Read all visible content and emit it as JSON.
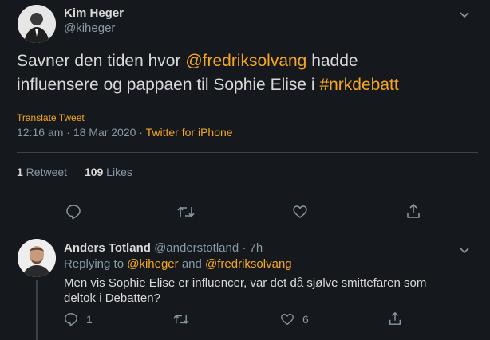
{
  "main_tweet": {
    "author_name": "Kim Heger",
    "author_handle": "@kiheger",
    "text_part1": "Savner den tiden hvor ",
    "mention": "@fredriksolvang",
    "text_part2": " hadde",
    "text_line2": "influensere og pappaen til Sophie Elise i ",
    "hashtag": "#nrkdebatt",
    "translate_label": "Translate Tweet",
    "timestamp": "12:16 am · 18 Mar 2020 · ",
    "source": "Twitter for iPhone",
    "retweet_count": "1",
    "retweet_label": " Retweet",
    "likes_count": "109",
    "likes_label": " Likes"
  },
  "reply": {
    "author_name": "Anders Totland",
    "author_handle": "@anderstotland",
    "time": " · 7h",
    "replying_to_label": "Replying to ",
    "replying_to_1": "@kiheger",
    "replying_and": " and ",
    "replying_to_2": "@fredriksolvang",
    "text_line1": "Men vis Sophie Elise er influencer, var det då sjølve smittefaren som",
    "text_line2": "deltok i Debatten?",
    "reply_count": "1",
    "like_count": "6"
  },
  "colors": {
    "background": "#15181c",
    "accent": "#f5a623",
    "muted": "#8899a6",
    "text": "#d9d9d9",
    "divider": "#38444d"
  },
  "icons": [
    "chevron-down-icon",
    "reply-icon",
    "retweet-icon",
    "like-icon",
    "share-icon"
  ]
}
